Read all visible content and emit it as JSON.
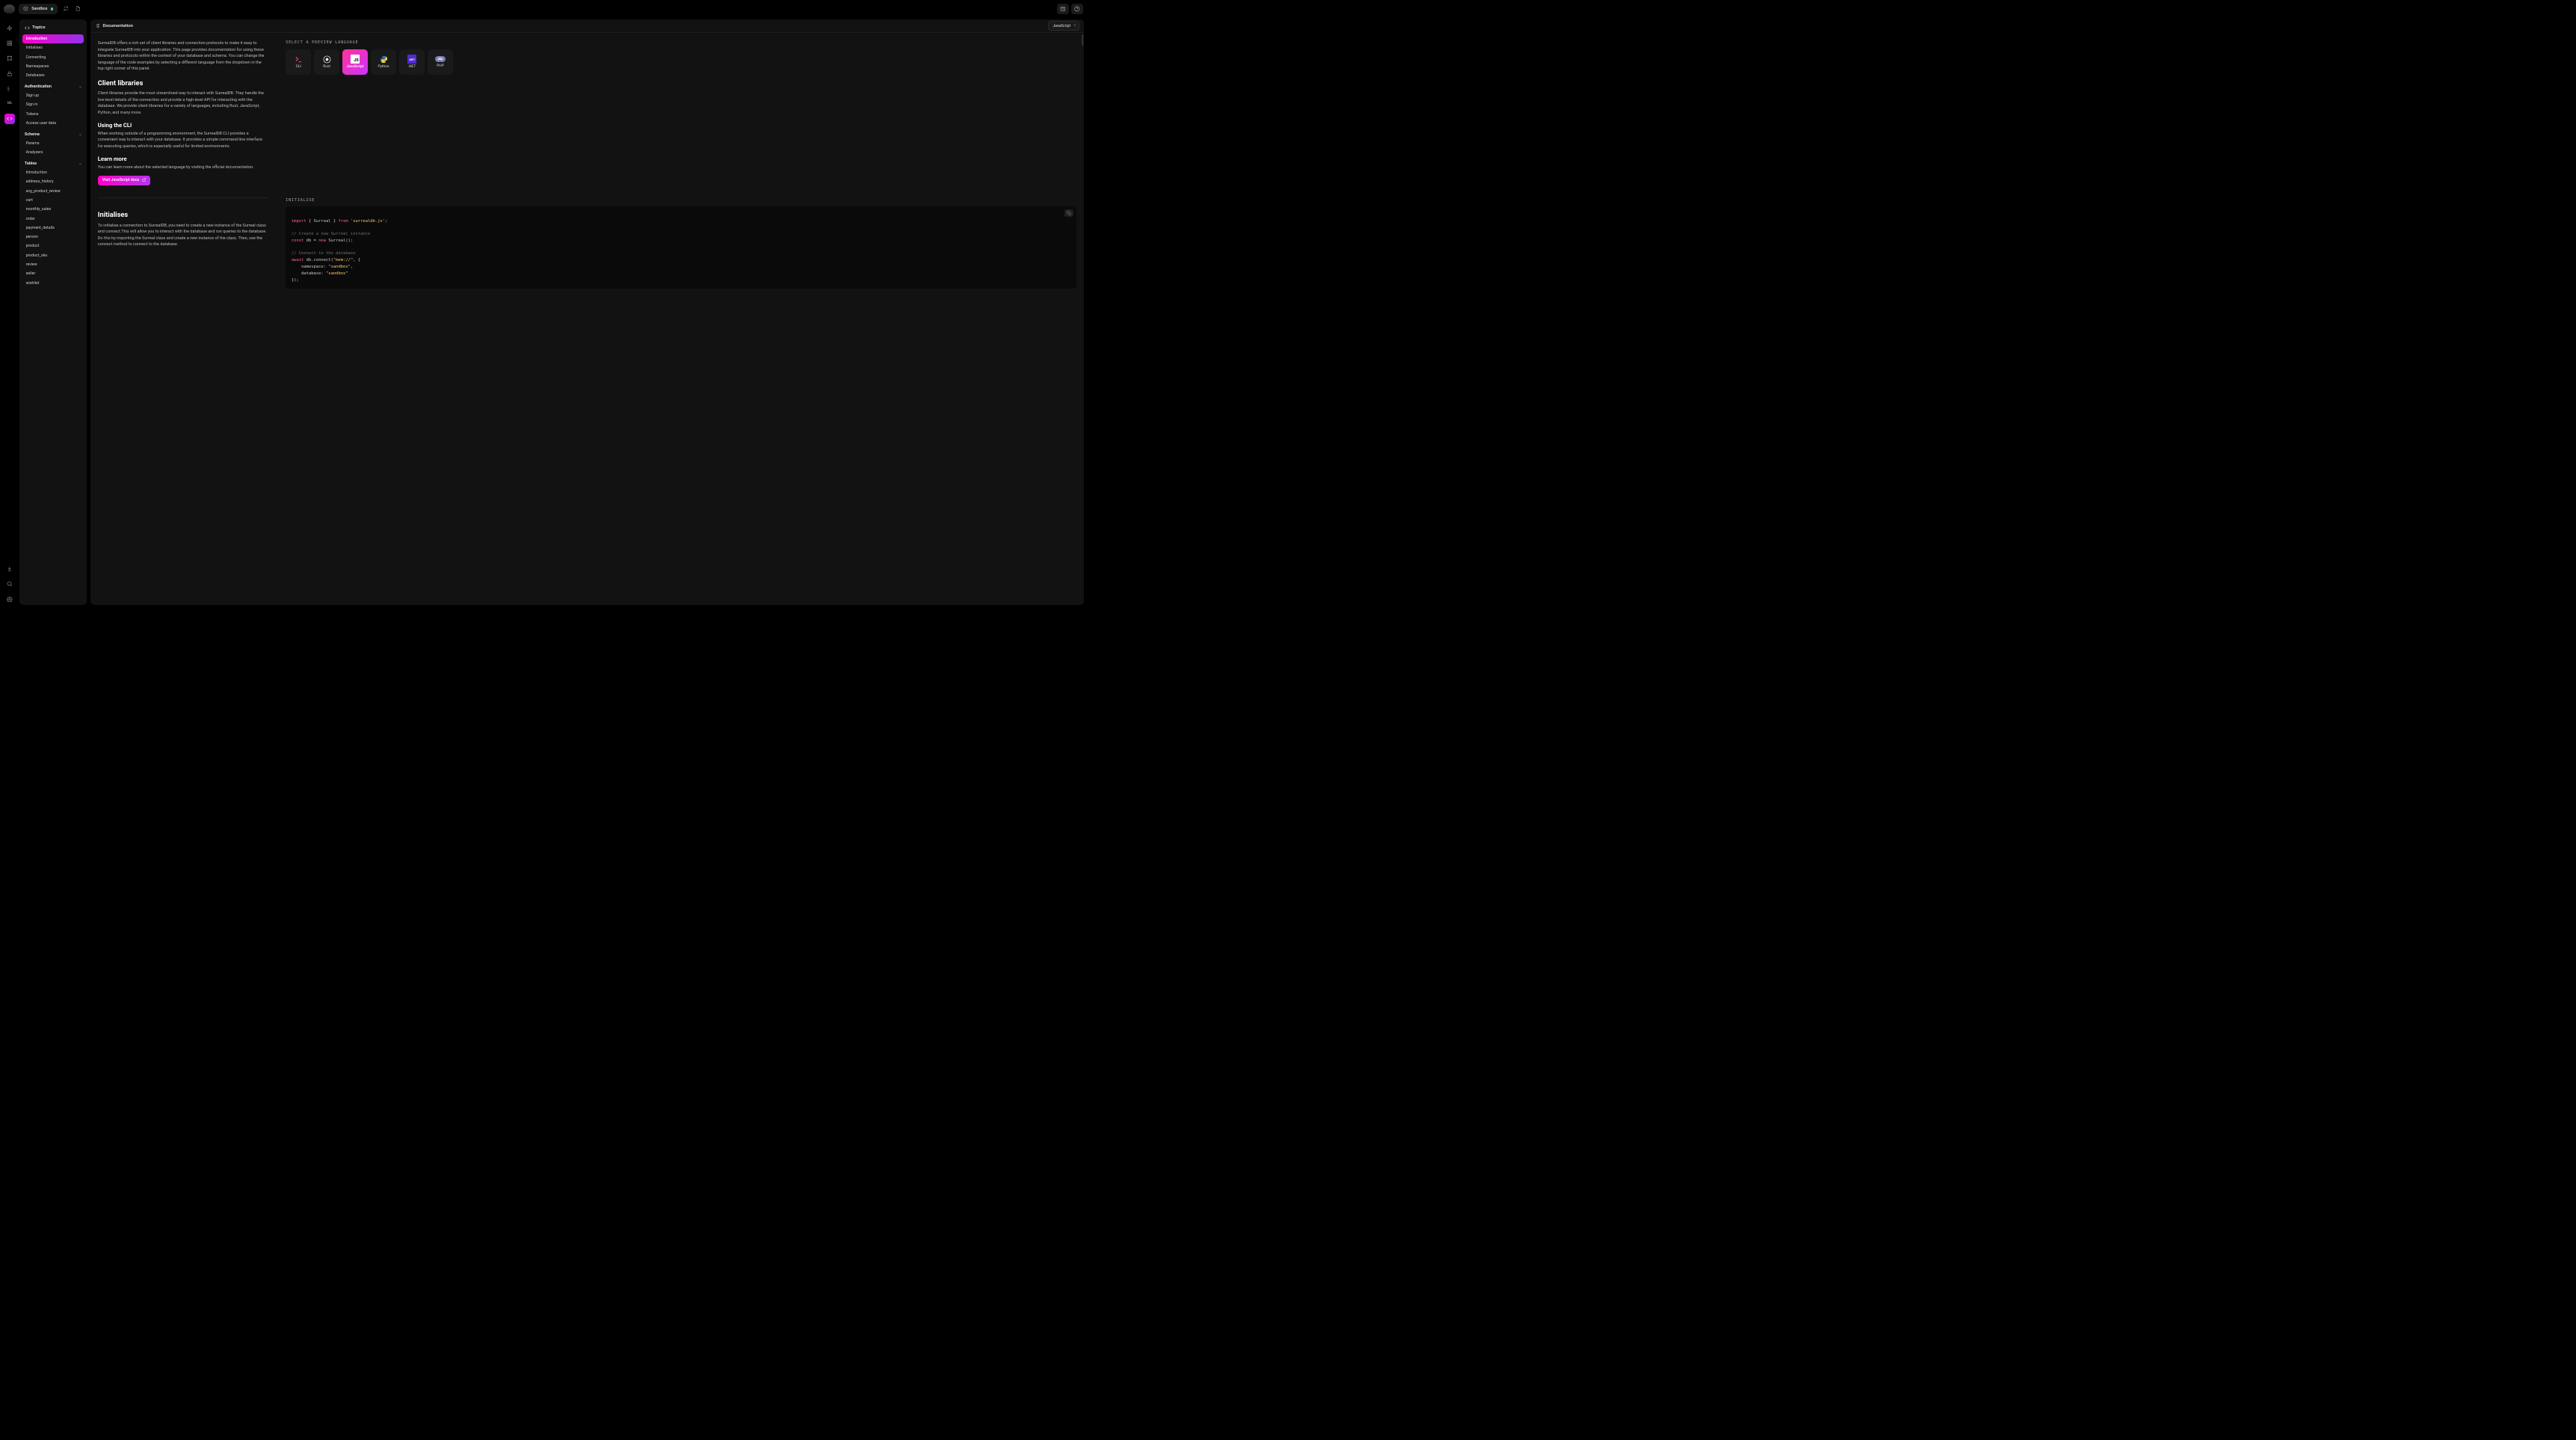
{
  "topbar": {
    "env_label": "Sandbox"
  },
  "sidebar": {
    "title": "Topics",
    "items": [
      {
        "label": "Introduction",
        "active": true
      },
      {
        "label": "Initialises"
      },
      {
        "label": "Connecting"
      },
      {
        "label": "Namespaces"
      },
      {
        "label": "Databases"
      }
    ],
    "groups": [
      {
        "label": "Authentication",
        "items": [
          "Sign up",
          "Sign in",
          "Tokens",
          "Access user data"
        ]
      },
      {
        "label": "Schema",
        "items": [
          "Params",
          "Analyzers"
        ]
      },
      {
        "label": "Tables",
        "items": [
          "Introduction",
          "address_history",
          "avg_product_review",
          "cart",
          "monthly_sales",
          "order",
          "payment_details",
          "person",
          "product",
          "product_sku",
          "review",
          "seller",
          "wishlist"
        ]
      }
    ]
  },
  "header": {
    "title": "Documentation",
    "selected_language": "JavaScript"
  },
  "doc": {
    "intro": "SurrealDB offers a rich set of client libraries and connection protocols to make it easy to integrate SurrealDB into your application. This page provides documentation for using these libraries and protocols within the context of your database and schema. You can change the language of the code examples by selecting a different language from the dropdown in the top right corner of this panel.",
    "client_h": "Client libraries",
    "client_p": "Client libraries provide the most streamlined way to interact with SurrealDB. They handle the low-level details of the connection and provide a high-level API for interacting with the database. We provide client libraries for a variety of languages, including Rust, JavaScript, Python, and many more.",
    "cli_h": "Using the CLI",
    "cli_p": "When working outside of a programming environment, the SurrealDB CLI provides a convenient way to interact with your database. It provides a simple command-line interface for executing queries, which is especially useful for limited environments.",
    "learn_h": "Learn more",
    "learn_p": "You can learn more about the selected language by visiting the official documentation.",
    "visit_btn": "Visit JavaScript docs",
    "init_h": "Initialises",
    "init_p": "To initialise a connection to SurrealDB, you need to create a new instance of the Surreal class and connect.This will allow you to interact with the database and run queries to the database. Do this by importing the Surreal class and create a new instance of the class. Then, use the connect method to connect to the database."
  },
  "preview": {
    "label": "SELECT A PREVIEW LANGUAGE",
    "languages": [
      "CLI",
      "Rust",
      "JavaScript",
      "Python",
      ".NET",
      "PHP"
    ],
    "active": "JavaScript",
    "init_label": "INITIALISE",
    "code": {
      "l1_import": "import",
      "l1_surreal": "Surreal",
      "l1_from": "from",
      "l1_path": "'surrealdb.js'",
      "l2_comment": "// Create a new Surreal instance",
      "l3_const": "const",
      "l3_db": "db",
      "l3_new": "new",
      "l3_cls": "Surreal",
      "l4_comment": "// Connect to the database",
      "l5_await": "await",
      "l5_db": "db",
      "l5_connect": "connect",
      "l5_mem": "\"mem://\"",
      "l6_ns_key": "namespace",
      "l6_ns_val": "\"sandbox\"",
      "l7_db_key": "database",
      "l7_db_val": "\"sandbox\""
    }
  }
}
